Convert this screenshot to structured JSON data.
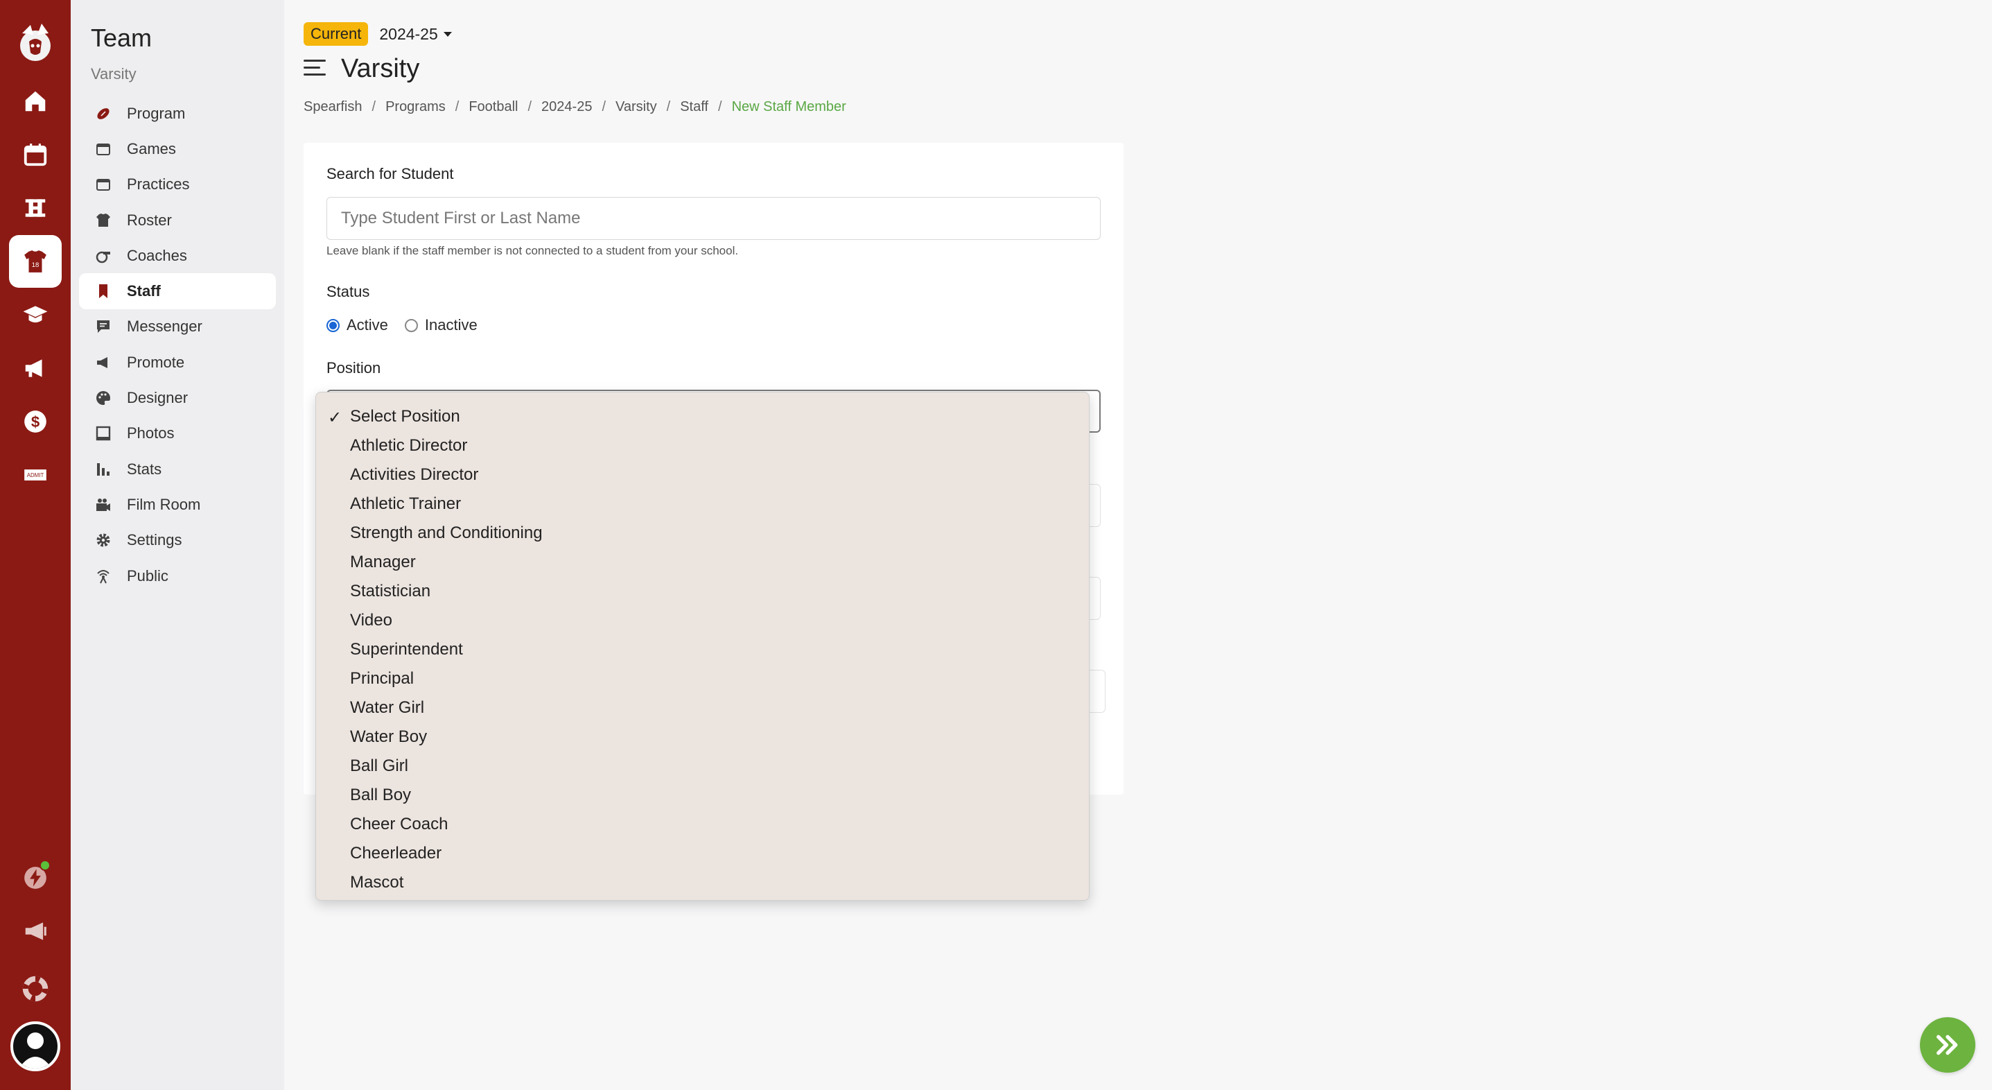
{
  "colors": {
    "brand": "#8b1a14",
    "accent": "#5aa843",
    "badge": "#f5b50a",
    "radio": "#1a66d4",
    "fab": "#6db33f"
  },
  "rail": {
    "items": [
      {
        "name": "home-icon"
      },
      {
        "name": "calendar-icon"
      },
      {
        "name": "bracket-icon"
      },
      {
        "name": "team-jersey-icon"
      },
      {
        "name": "graduation-cap-icon"
      },
      {
        "name": "megaphone-icon"
      },
      {
        "name": "dollar-icon"
      },
      {
        "name": "ticket-icon"
      }
    ],
    "bottom": [
      {
        "name": "bolt-icon"
      },
      {
        "name": "announcement-icon"
      },
      {
        "name": "help-lifebuoy-icon"
      },
      {
        "name": "user-avatar-icon"
      }
    ]
  },
  "sidebar": {
    "title": "Team",
    "subtitle": "Varsity",
    "items": [
      {
        "label": "Program",
        "icon": "football-icon"
      },
      {
        "label": "Games",
        "icon": "calendar-icon"
      },
      {
        "label": "Practices",
        "icon": "calendar-icon"
      },
      {
        "label": "Roster",
        "icon": "jersey-icon"
      },
      {
        "label": "Coaches",
        "icon": "whistle-icon"
      },
      {
        "label": "Staff",
        "icon": "bookmark-icon",
        "active": true
      },
      {
        "label": "Messenger",
        "icon": "chat-icon"
      },
      {
        "label": "Promote",
        "icon": "megaphone-icon"
      },
      {
        "label": "Designer",
        "icon": "palette-icon"
      },
      {
        "label": "Photos",
        "icon": "photo-icon"
      },
      {
        "label": "Stats",
        "icon": "bar-chart-icon"
      },
      {
        "label": "Film Room",
        "icon": "video-camera-icon"
      },
      {
        "label": "Settings",
        "icon": "gear-icon"
      },
      {
        "label": "Public",
        "icon": "broadcast-icon"
      }
    ]
  },
  "header": {
    "badge": "Current",
    "season": "2024-25",
    "title": "Varsity"
  },
  "breadcrumb": [
    "Spearfish",
    "Programs",
    "Football",
    "2024-25",
    "Varsity",
    "Staff",
    "New Staff Member"
  ],
  "form": {
    "search_label": "Search for Student",
    "search_placeholder": "Type Student First or Last Name",
    "search_value": "",
    "help_text": "Leave blank if the staff member is not connected to a student from your school.",
    "status_label": "Status",
    "status_active": "Active",
    "status_inactive": "Inactive",
    "status_selected": "Active",
    "position_label": "Position",
    "position_selected": "Select Position"
  },
  "position_options": [
    "Select Position",
    "Athletic Director",
    "Activities Director",
    "Athletic Trainer",
    "Strength and Conditioning",
    "Manager",
    "Statistician",
    "Video",
    "Superintendent",
    "Principal",
    "Water Girl",
    "Water Boy",
    "Ball Girl",
    "Ball Boy",
    "Cheer Coach",
    "Cheerleader",
    "Mascot"
  ],
  "fab": {
    "icon": "double-chevron-right-icon"
  }
}
